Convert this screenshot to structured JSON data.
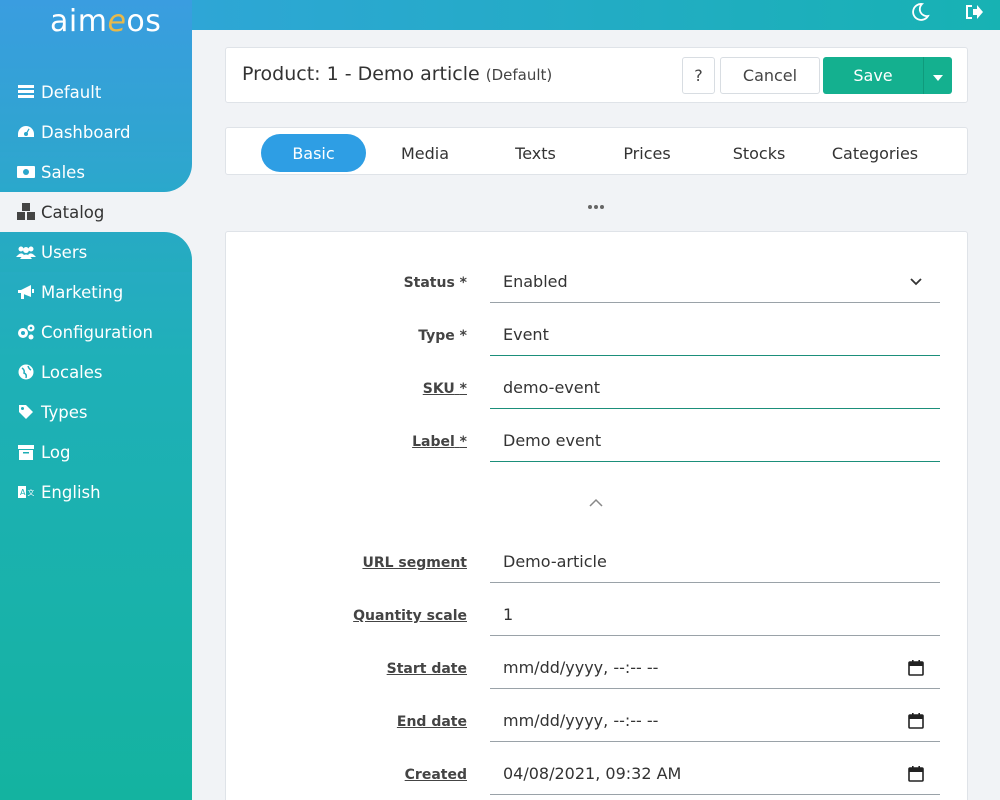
{
  "app": {
    "logo_prefix": "aim",
    "logo_accent": "e",
    "logo_suffix": "os"
  },
  "sidebar": {
    "items": [
      {
        "label": "Default",
        "icon": "list-icon"
      },
      {
        "label": "Dashboard",
        "icon": "gauge-icon"
      },
      {
        "label": "Sales",
        "icon": "money-icon"
      },
      {
        "label": "Catalog",
        "icon": "cubes-icon",
        "active": true
      },
      {
        "label": "Users",
        "icon": "users-icon"
      },
      {
        "label": "Marketing",
        "icon": "megaphone-icon"
      },
      {
        "label": "Configuration",
        "icon": "gears-icon"
      },
      {
        "label": "Locales",
        "icon": "globe-icon"
      },
      {
        "label": "Types",
        "icon": "tag-icon"
      },
      {
        "label": "Log",
        "icon": "archive-icon"
      },
      {
        "label": "English",
        "icon": "language-icon"
      }
    ]
  },
  "topbar": {
    "theme_icon": "moon-icon",
    "logout_icon": "logout-icon"
  },
  "header": {
    "title": "Product: 1 - Demo article",
    "subtitle": "(Default)",
    "help_label": "?",
    "cancel_label": "Cancel",
    "save_label": "Save"
  },
  "tabs": [
    {
      "label": "Basic",
      "active": true
    },
    {
      "label": "Media"
    },
    {
      "label": "Texts"
    },
    {
      "label": "Prices"
    },
    {
      "label": "Stocks"
    },
    {
      "label": "Categories"
    }
  ],
  "form": {
    "status": {
      "label": "Status *",
      "value": "Enabled"
    },
    "type": {
      "label": "Type *",
      "value": "Event"
    },
    "sku": {
      "label": "SKU",
      "required": "*",
      "value": "demo-event"
    },
    "label": {
      "label": "Label",
      "required": "*",
      "value": "Demo event"
    },
    "url_segment": {
      "label": "URL segment",
      "value": "Demo-article"
    },
    "quantity_scale": {
      "label": "Quantity scale",
      "value": "1"
    },
    "start_date": {
      "label": "Start date",
      "value": "mm/dd/yyyy, --:-- --"
    },
    "end_date": {
      "label": "End date",
      "value": "mm/dd/yyyy, --:-- --"
    },
    "created": {
      "label": "Created",
      "value": "04/08/2021, 09:32 AM"
    }
  },
  "colors": {
    "accent_blue": "#2e9ee4",
    "save_green": "#14b08f",
    "sidebar_top": "#3a9de0",
    "sidebar_bottom": "#14b3a0"
  }
}
